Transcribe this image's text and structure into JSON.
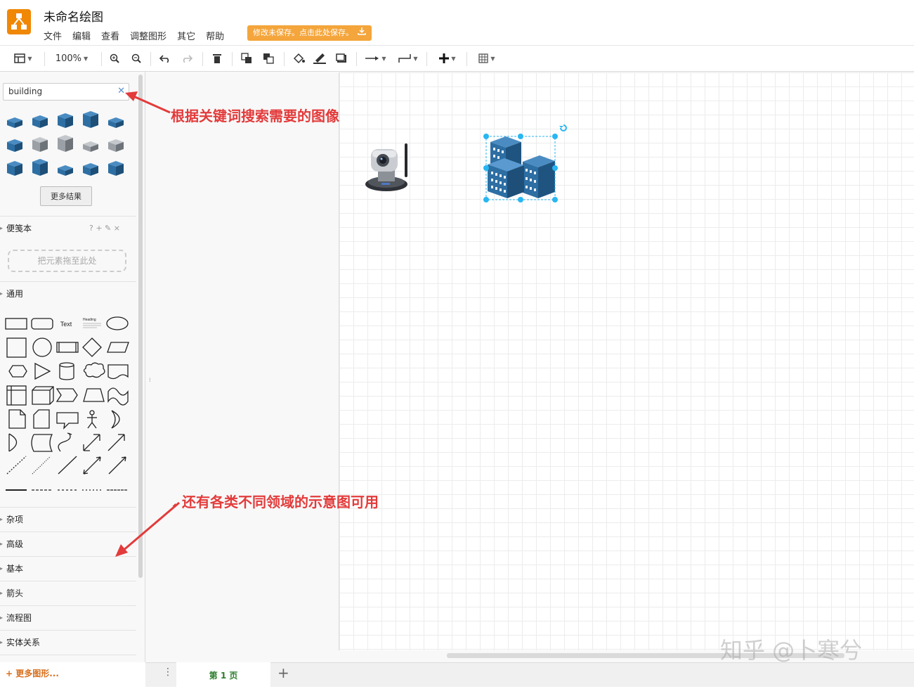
{
  "header": {
    "title": "未命名绘图",
    "menus": [
      "文件",
      "编辑",
      "查看",
      "调整图形",
      "其它",
      "帮助"
    ],
    "save_warning": "修改未保存。点击此处保存。"
  },
  "toolbar": {
    "zoom": "100%"
  },
  "sidebar": {
    "search_value": "building",
    "more_results": "更多结果",
    "scratchpad": {
      "title": "便笺本",
      "actions": "? + ✎ ×",
      "drop_hint": "把元素拖至此处"
    },
    "general": {
      "title": "通用",
      "text_shape": "Text",
      "heading_shape": "Heading"
    },
    "sections": [
      "杂项",
      "高级",
      "基本",
      "箭头",
      "流程图",
      "实体关系"
    ],
    "more_shapes": "+ 更多图形..."
  },
  "footer": {
    "page_tab": "第 1 页",
    "add_page": "+"
  },
  "annotations": {
    "search_hint": "根据关键词搜索需要的图像",
    "domains_hint": "还有各类不同领域的示意图可用"
  },
  "watermark": "知乎 @卜寒兮",
  "colors": {
    "accent": "#f08705",
    "annotation": "#e33b3b",
    "selection": "#29b6f2",
    "building": "#2d6ea3"
  }
}
